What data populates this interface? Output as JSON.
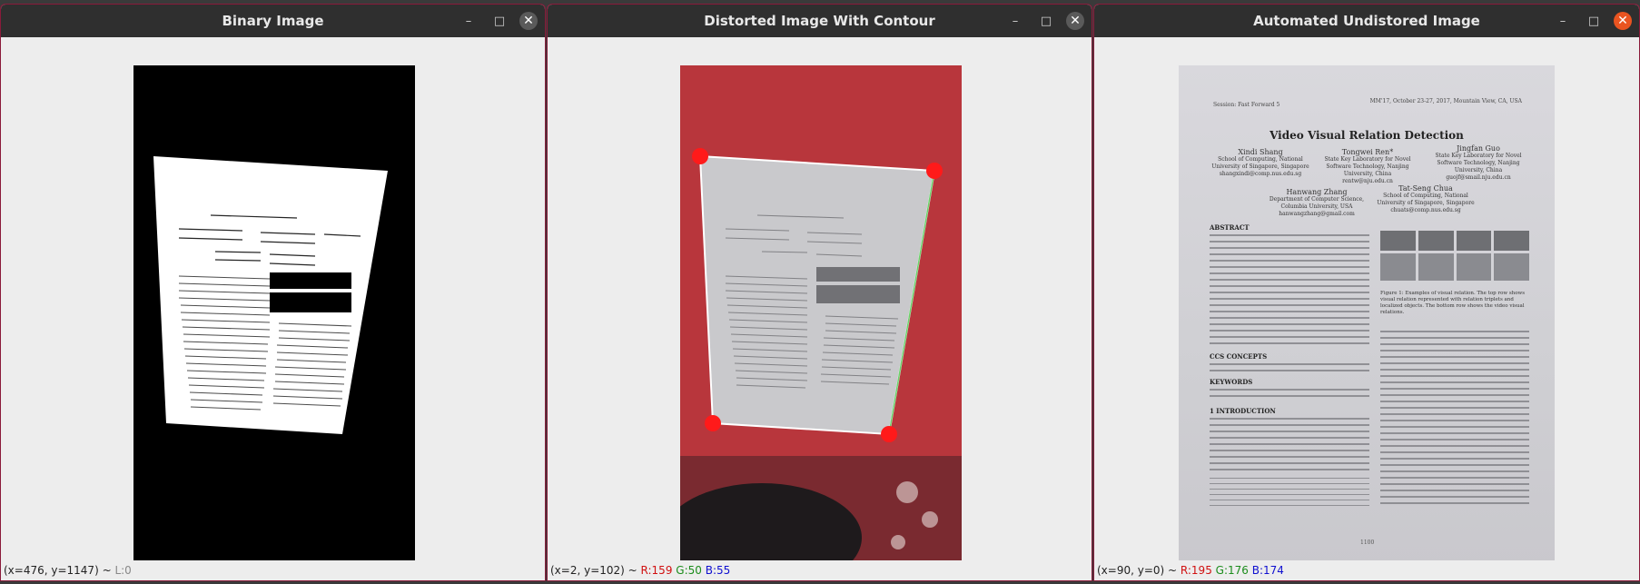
{
  "windows": [
    {
      "title": "Binary Image",
      "status": {
        "coords": "(x=476, y=1147) ~ ",
        "channels": [
          {
            "text": "L:0",
            "color": "#888888"
          }
        ]
      }
    },
    {
      "title": "Distorted Image With Contour",
      "status": {
        "coords": "(x=2, y=102) ~ ",
        "channels": [
          {
            "text": "R:159",
            "color": "#d01010"
          },
          {
            "text": "G:50",
            "color": "#1c8c1c"
          },
          {
            "text": "B:55",
            "color": "#1010d0"
          }
        ]
      }
    },
    {
      "title": "Automated Undistored Image",
      "status": {
        "coords": "(x=90, y=0) ~ ",
        "channels": [
          {
            "text": "R:195",
            "color": "#d01010"
          },
          {
            "text": "G:176",
            "color": "#1c8c1c"
          },
          {
            "text": "B:174",
            "color": "#1010d0"
          }
        ]
      }
    }
  ],
  "controls": {
    "minimize": "–",
    "maximize": "□",
    "close": "✕"
  },
  "document": {
    "header_left": "Session: Fast Forward 5",
    "header_right": "MM'17, October 23-27, 2017, Mountain View, CA, USA",
    "title": "Video Visual Relation Detection",
    "authors": [
      {
        "name": "Xindi Shang",
        "affil": "School of Computing, National\nUniversity of Singapore, Singapore\nshangxindi@comp.nus.edu.sg"
      },
      {
        "name": "Tongwei Ren*",
        "affil": "State Key Laboratory for Novel\nSoftware Technology, Nanjing\nUniversity, China\nrentw@nju.edu.cn"
      },
      {
        "name": "Jingfan Guo",
        "affil": "State Key Laboratory for Novel\nSoftware Technology, Nanjing\nUniversity, China\nguojf@smail.nju.edu.cn"
      },
      {
        "name": "Hanwang Zhang",
        "affil": "Department of Computer Science,\nColumbia University, USA\nhanwangzhang@gmail.com"
      },
      {
        "name": "Tat-Seng Chua",
        "affil": "School of Computing, National\nUniversity of Singapore, Singapore\nchuats@comp.nus.edu.sg"
      }
    ],
    "sections": [
      "ABSTRACT",
      "CCS CONCEPTS",
      "KEYWORDS",
      "1 INTRODUCTION"
    ],
    "figure_caption": "Figure 1: Examples of visual relation. The top row shows visual relation represented with relation triplets and localized objects. The bottom row shows the video visual relations.",
    "page_number": "1100"
  },
  "colors": {
    "titlebar": "#2f2f2f",
    "window_border": "#8a1a3a",
    "close_active": "#e95420",
    "contour_marker": "#ff1a1a",
    "contour_line": "#ffffff",
    "red_background": "#b8363c"
  }
}
